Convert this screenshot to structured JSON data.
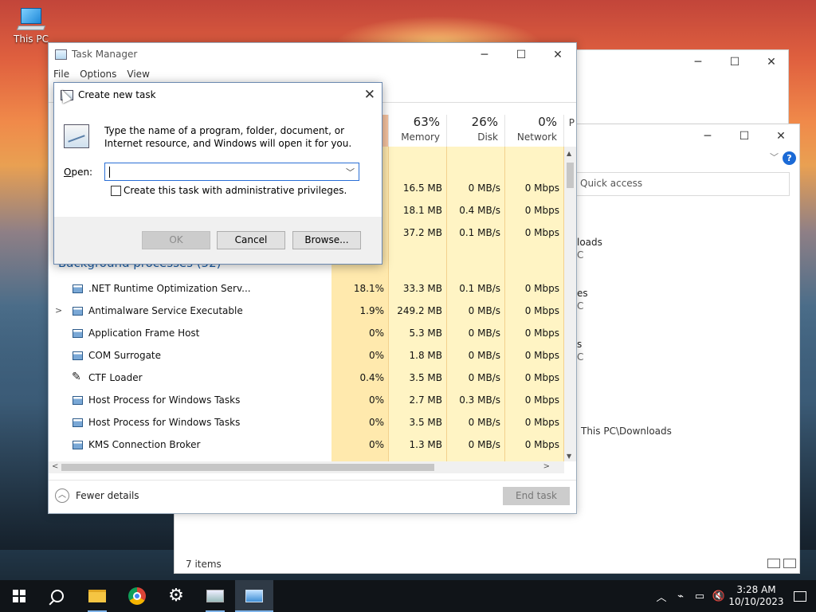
{
  "desktop": {
    "this_pc_label": "This PC"
  },
  "explorer": {
    "search_placeholder": "Quick access",
    "items": [
      {
        "label": "loads",
        "sub": "C"
      },
      {
        "label": "es",
        "sub": "C"
      },
      {
        "label": "s",
        "sub": "C"
      }
    ],
    "path_text": "This PC\\Downloads",
    "status": "7 items",
    "help_glyph": "?"
  },
  "task_manager": {
    "title": "Task Manager",
    "menu": [
      "File",
      "Options",
      "View"
    ],
    "columns": [
      {
        "pct": "63%",
        "label": "Memory"
      },
      {
        "pct": "26%",
        "label": "Disk"
      },
      {
        "pct": "0%",
        "label": "Network"
      },
      {
        "pct": "",
        "label": "P"
      }
    ],
    "top_rows": [
      {
        "memory": "16.5 MB",
        "disk": "0 MB/s",
        "network": "0 Mbps"
      },
      {
        "memory": "18.1 MB",
        "disk": "0.4 MB/s",
        "network": "0 Mbps"
      },
      {
        "memory": "37.2 MB",
        "disk": "0.1 MB/s",
        "network": "0 Mbps"
      }
    ],
    "group_label": "Background processes (52)",
    "rows": [
      {
        "name": ".NET Runtime Optimization Serv...",
        "cpu": "18.1%",
        "memory": "33.3 MB",
        "disk": "0.1 MB/s",
        "network": "0 Mbps",
        "expandable": false,
        "icon": "app"
      },
      {
        "name": "Antimalware Service Executable",
        "cpu": "1.9%",
        "memory": "249.2 MB",
        "disk": "0 MB/s",
        "network": "0 Mbps",
        "expandable": true,
        "icon": "app"
      },
      {
        "name": "Application Frame Host",
        "cpu": "0%",
        "memory": "5.3 MB",
        "disk": "0 MB/s",
        "network": "0 Mbps",
        "expandable": false,
        "icon": "app"
      },
      {
        "name": "COM Surrogate",
        "cpu": "0%",
        "memory": "1.8 MB",
        "disk": "0 MB/s",
        "network": "0 Mbps",
        "expandable": false,
        "icon": "app"
      },
      {
        "name": "CTF Loader",
        "cpu": "0.4%",
        "memory": "3.5 MB",
        "disk": "0 MB/s",
        "network": "0 Mbps",
        "expandable": false,
        "icon": "pen"
      },
      {
        "name": "Host Process for Windows Tasks",
        "cpu": "0%",
        "memory": "2.7 MB",
        "disk": "0.3 MB/s",
        "network": "0 Mbps",
        "expandable": false,
        "icon": "app"
      },
      {
        "name": "Host Process for Windows Tasks",
        "cpu": "0%",
        "memory": "3.5 MB",
        "disk": "0 MB/s",
        "network": "0 Mbps",
        "expandable": false,
        "icon": "app"
      },
      {
        "name": "KMS Connection Broker",
        "cpu": "0%",
        "memory": "1.3 MB",
        "disk": "0 MB/s",
        "network": "0 Mbps",
        "expandable": false,
        "icon": "app"
      }
    ],
    "fewer_details": "Fewer details",
    "end_task": "End task"
  },
  "run_dialog": {
    "title": "Create new task",
    "description": "Type the name of a program, folder, document, or Internet resource, and Windows will open it for you.",
    "open_label": "Open:",
    "open_value": "",
    "admin_label": "Create this task with administrative privileges.",
    "ok": "OK",
    "cancel": "Cancel",
    "browse": "Browse..."
  },
  "taskbar": {
    "time": "3:28 AM",
    "date": "10/10/2023",
    "apps": [
      "start-icon",
      "search-icon",
      "file-explorer-icon",
      "chrome-icon",
      "settings-icon",
      "task-manager-icon",
      "run-icon"
    ]
  }
}
